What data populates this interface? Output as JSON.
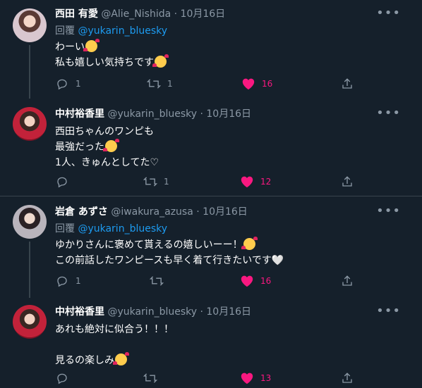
{
  "tweets": [
    {
      "name": "西田 有愛",
      "handle": "@Alie_Nishida",
      "dot": "·",
      "date": "10月16日",
      "reply_prefix": "回覆",
      "reply_to": "@yukarin_bluesky",
      "lines": [
        "わーい",
        "私も嬉しい気持ちです"
      ],
      "replies": "1",
      "retweets": "1",
      "likes": "16"
    },
    {
      "name": "中村裕香里",
      "handle": "@yukarin_bluesky",
      "dot": "·",
      "date": "10月16日",
      "lines": [
        "西田ちゃんのワンピも",
        "最強だった",
        "1人、きゅんとしてた♡"
      ],
      "replies": "",
      "retweets": "1",
      "likes": "12"
    },
    {
      "name": "岩倉 あずさ",
      "handle": "@iwakura_azusa",
      "dot": "·",
      "date": "10月16日",
      "reply_prefix": "回覆",
      "reply_to": "@yukarin_bluesky",
      "lines": [
        "ゆかりさんに褒めて貰えるの嬉しいーー！",
        "この前話したワンピースも早く着て行きたいです🤍"
      ],
      "replies": "1",
      "retweets": "",
      "likes": "16"
    },
    {
      "name": "中村裕香里",
      "handle": "@yukarin_bluesky",
      "dot": "·",
      "date": "10月16日",
      "lines": [
        "あれも絶対に似合う！！！",
        "",
        "見るの楽しみ"
      ],
      "replies": "",
      "retweets": "",
      "likes": "13"
    }
  ],
  "icons": {
    "more": "more-icon",
    "reply": "reply-icon",
    "retweet": "retweet-icon",
    "like": "heart-icon",
    "share": "share-icon"
  },
  "colors": {
    "background": "#15202b",
    "secondary_text": "#8b98a5",
    "link": "#1d9bf0",
    "like": "#f91880",
    "divider": "#38444d"
  }
}
